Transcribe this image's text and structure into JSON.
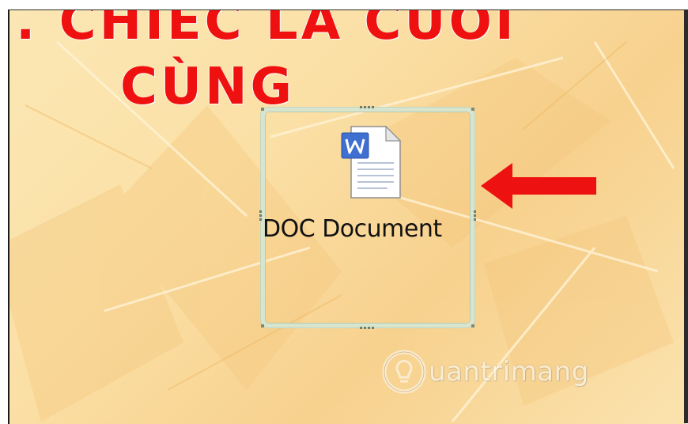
{
  "slide": {
    "title_line1": ". CHIẾC LÁ CUỐI",
    "title_line2": "CÙNG",
    "title_color": "#ef1010"
  },
  "embedded_object": {
    "icon": "word-document-icon",
    "label": "DOC Document",
    "selected": true
  },
  "annotation": {
    "icon": "left-arrow-icon",
    "color": "#ee1111"
  },
  "watermark": {
    "icon": "lightbulb-icon",
    "text": "uantrimang"
  }
}
